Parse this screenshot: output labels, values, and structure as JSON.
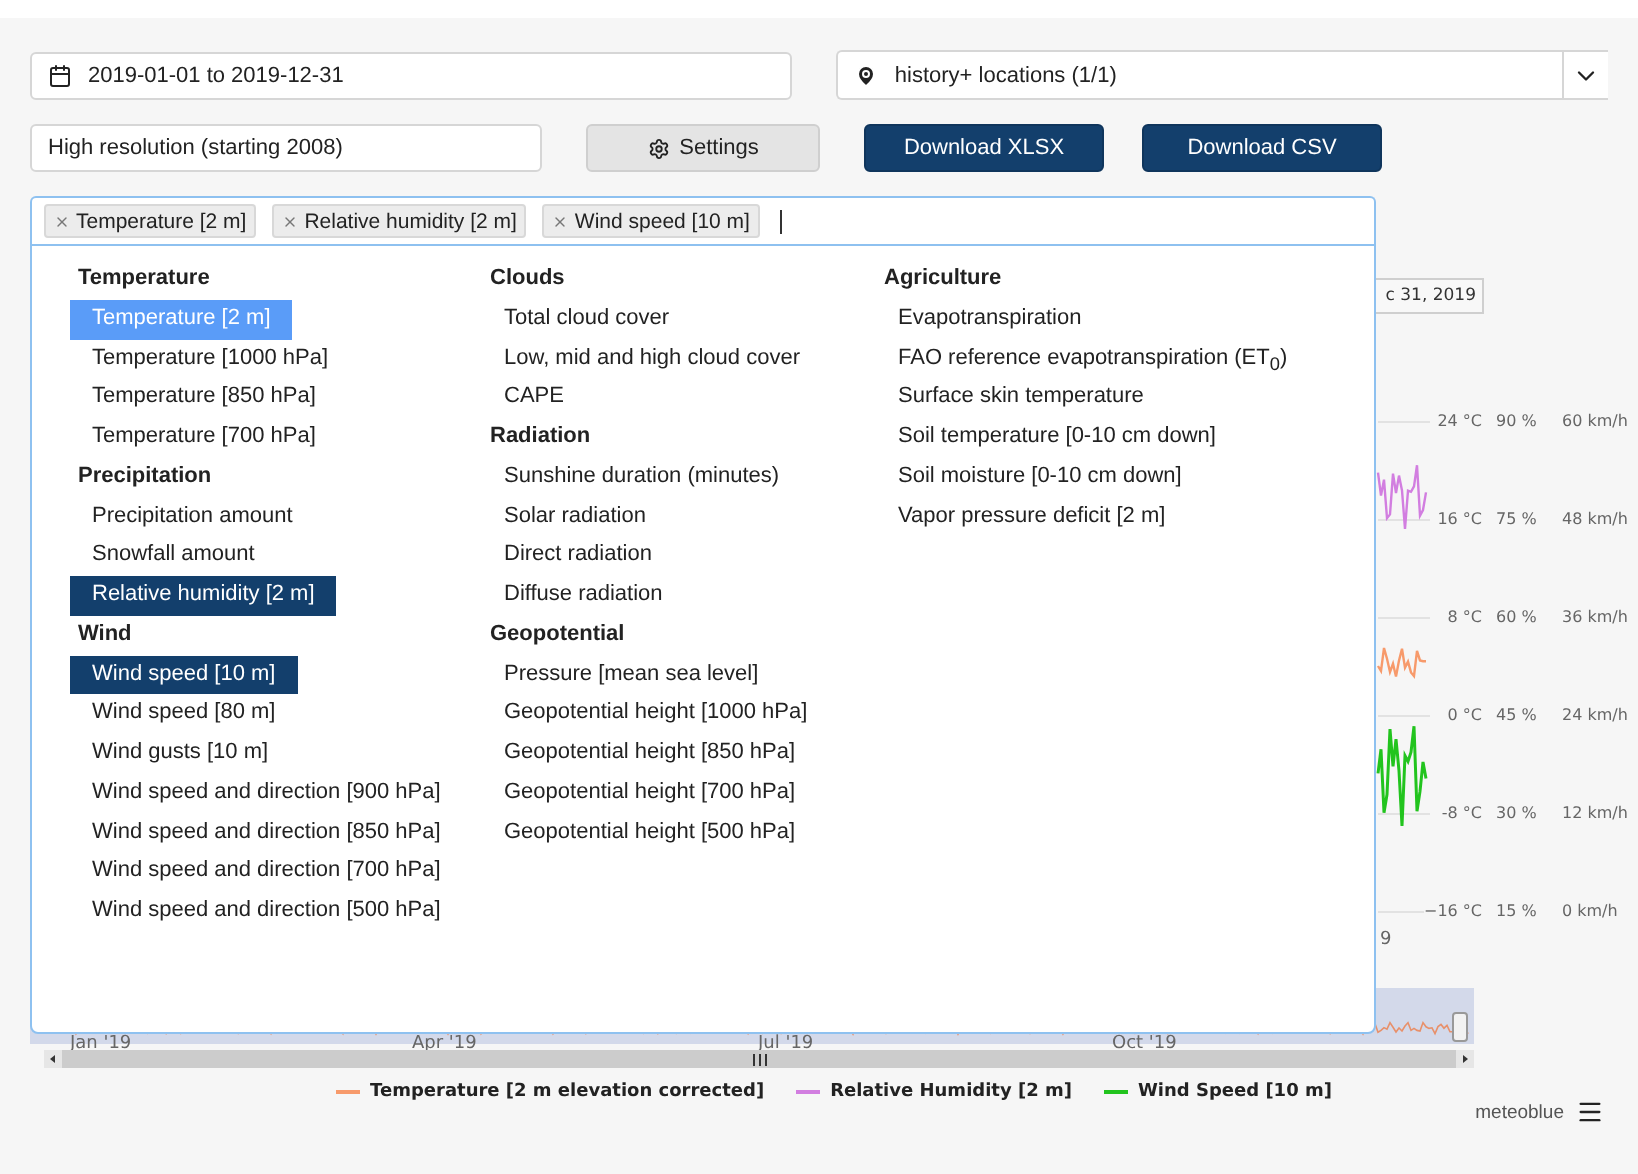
{
  "date_range": {
    "value": "2019-01-01 to 2019-12-31"
  },
  "location": {
    "value": "history+ locations (1/1)"
  },
  "resolution": {
    "value": "High resolution (starting 2008)"
  },
  "buttons": [
    {
      "kind": "settings",
      "label": "Settings"
    },
    {
      "kind": "primary",
      "label": "Download XLSX"
    },
    {
      "kind": "primary",
      "label": "Download CSV"
    }
  ],
  "selected_tags": [
    "Temperature [2 m]",
    "Relative humidity [2 m]",
    "Wind speed [10 m]"
  ],
  "dropdown": {
    "columns": [
      [
        {
          "group": "Temperature",
          "items": [
            {
              "label": "Temperature [2 m]",
              "selected": true,
              "focused": true
            },
            {
              "label": "Temperature [1000 hPa]",
              "selected": false,
              "focused": false
            },
            {
              "label": "Temperature [850 hPa]",
              "selected": false,
              "focused": false
            },
            {
              "label": "Temperature [700 hPa]",
              "selected": false,
              "focused": false
            }
          ]
        },
        {
          "group": "Precipitation",
          "items": [
            {
              "label": "Precipitation amount",
              "selected": false,
              "focused": false
            },
            {
              "label": "Snowfall amount",
              "selected": false,
              "focused": false
            },
            {
              "label": "Relative humidity [2 m]",
              "selected": true,
              "focused": false
            }
          ]
        },
        {
          "group": "Wind",
          "items": [
            {
              "label": "Wind speed [10 m]",
              "selected": true,
              "focused": false
            },
            {
              "label": "Wind speed [80 m]",
              "selected": false,
              "focused": false
            },
            {
              "label": "Wind gusts [10 m]",
              "selected": false,
              "focused": false
            },
            {
              "label": "Wind speed and direction [900 hPa]",
              "selected": false,
              "focused": false
            },
            {
              "label": "Wind speed and direction [850 hPa]",
              "selected": false,
              "focused": false
            },
            {
              "label": "Wind speed and direction [700 hPa]",
              "selected": false,
              "focused": false
            },
            {
              "label": "Wind speed and direction [500 hPa]",
              "selected": false,
              "focused": false
            }
          ]
        }
      ],
      [
        {
          "group": "Clouds",
          "items": [
            {
              "label": "Total cloud cover",
              "selected": false,
              "focused": false
            },
            {
              "label": "Low, mid and high cloud cover",
              "selected": false,
              "focused": false
            },
            {
              "label": "CAPE",
              "selected": false,
              "focused": false
            }
          ]
        },
        {
          "group": "Radiation",
          "items": [
            {
              "label": "Sunshine duration (minutes)",
              "selected": false,
              "focused": false
            },
            {
              "label": "Solar radiation",
              "selected": false,
              "focused": false
            },
            {
              "label": "Direct radiation",
              "selected": false,
              "focused": false
            },
            {
              "label": "Diffuse radiation",
              "selected": false,
              "focused": false
            }
          ]
        },
        {
          "group": "Geopotential",
          "items": [
            {
              "label": "Pressure [mean sea level]",
              "selected": false,
              "focused": false
            },
            {
              "label": "Geopotential height [1000 hPa]",
              "selected": false,
              "focused": false
            },
            {
              "label": "Geopotential height [850 hPa]",
              "selected": false,
              "focused": false
            },
            {
              "label": "Geopotential height [700 hPa]",
              "selected": false,
              "focused": false
            },
            {
              "label": "Geopotential height [500 hPa]",
              "selected": false,
              "focused": false
            }
          ]
        }
      ],
      [
        {
          "group": "Agriculture",
          "items": [
            {
              "label": "Evapotranspiration",
              "selected": false,
              "focused": false
            },
            {
              "label": "FAO reference evapotranspiration (ET$_{0}$)",
              "selected": false,
              "focused": false
            },
            {
              "label": "Surface skin temperature",
              "selected": false,
              "focused": false
            },
            {
              "label": "Soil temperature [0-10 cm down]",
              "selected": false,
              "focused": false
            },
            {
              "label": "Soil moisture [0-10 cm down]",
              "selected": false,
              "focused": false
            },
            {
              "label": "Vapor pressure deficit [2 m]",
              "selected": false,
              "focused": false
            }
          ]
        }
      ]
    ]
  },
  "chart": {
    "date_box": "c 31, 2019",
    "axes": [
      [
        "24 °C",
        "16 °C",
        "8 °C",
        "0 °C",
        "-8 °C",
        "−16 °C"
      ],
      [
        "90 %",
        "75 %",
        "60 %",
        "45 %",
        "30 %",
        "15 %"
      ],
      [
        "60 km/h",
        "48 km/h",
        "36 km/h",
        "24 km/h",
        "12 km/h",
        "0 km/h"
      ]
    ],
    "x_label": "9",
    "navigator_labels": [
      "Jan '19",
      "Apr '19",
      "Jul '19",
      "Oct '19"
    ]
  },
  "legend": [
    {
      "label": "Temperature [2 m elevation corrected]",
      "color": "#f79a6b"
    },
    {
      "label": "Relative Humidity [2 m]",
      "color": "#d27ee0"
    },
    {
      "label": "Wind Speed [10 m]",
      "color": "#22c41e"
    }
  ],
  "credit": "meteoblue"
}
